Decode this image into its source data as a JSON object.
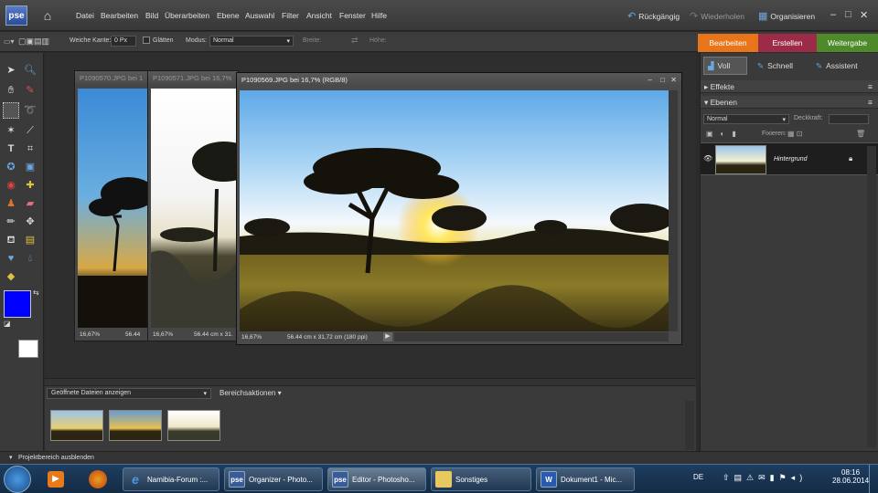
{
  "app": {
    "logo_text": "pse"
  },
  "menu": [
    "Datei",
    "Bearbeiten",
    "Bild",
    "Überarbeiten",
    "Ebene",
    "Auswahl",
    "Filter",
    "Ansicht",
    "Fenster",
    "Hilfe"
  ],
  "topbar": {
    "undo": "Rückgängig",
    "redo": "Wiederholen",
    "organizer": "Organisieren"
  },
  "modes": {
    "edit": "Bearbeiten",
    "create": "Erstellen",
    "share": "Weitergabe"
  },
  "options": {
    "feather_label": "Weiche Kante:",
    "feather_value": "0 Px",
    "antialias_label": "Glätten",
    "mode_label": "Modus:",
    "mode_value": "Normal",
    "width_label": "Breite:",
    "height_label": "Höhe:"
  },
  "edit_tabs": {
    "full": "Voll",
    "quick": "Schnell",
    "guided": "Assistent"
  },
  "panels": {
    "effects": "Effekte",
    "layers": "Ebenen",
    "blend_mode": "Normal",
    "opacity_label": "Deckkraft:",
    "lock_label": "Fixieren:",
    "layer_name": "Hintergrund"
  },
  "documents": [
    {
      "title": "P1090570.JPG bei 1",
      "zoom": "16,67%",
      "size": ""
    },
    {
      "title": "P1090571.JPG bei 16,7%",
      "zoom": "16,67%",
      "size": "56.44 cm x 31."
    },
    {
      "title": "P1090569.JPG bei 16,7% (RGB/8)",
      "zoom": "16,67%",
      "size": "56.44 cm x 31,72 cm (180 ppi)"
    }
  ],
  "doc1_partial_size": "56.44",
  "bin": {
    "dropdown": "Geöffnete Dateien anzeigen",
    "actions": "Bereichsaktionen",
    "hide_label": "Projektbereich ausblenden"
  },
  "taskbar": {
    "tasks": [
      {
        "label": "Namibia-Forum :...",
        "icon": "ie-icon"
      },
      {
        "label": "Organizer - Photo...",
        "icon": "pse-icon"
      },
      {
        "label": "Editor - Photosho...",
        "icon": "pse-icon"
      },
      {
        "label": "Sonstiges",
        "icon": "folder-icon"
      },
      {
        "label": "Dokument1 - Mic...",
        "icon": "word-icon"
      }
    ],
    "lang": "DE",
    "time": "08:16",
    "date": "28.06.2014"
  },
  "colors": {
    "edit_tab": "#e8751a",
    "create_tab": "#a02a4a",
    "share_tab": "#5a8a2a",
    "foreground": "#0000ff",
    "background": "#ffffff"
  }
}
